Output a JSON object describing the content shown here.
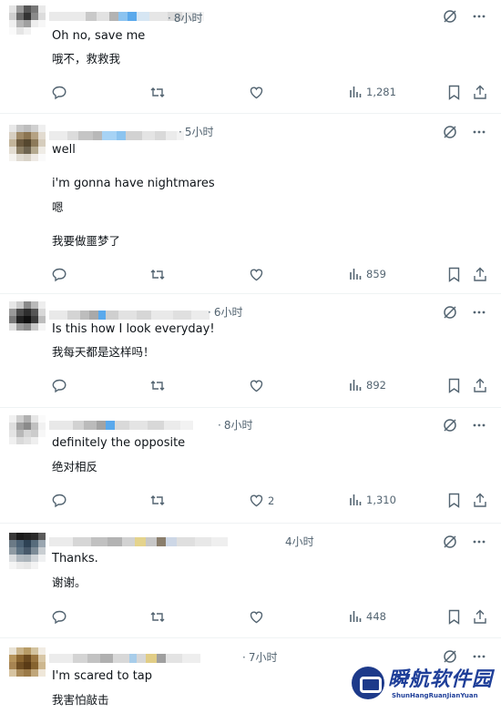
{
  "replies": [
    {
      "time": "8小时",
      "lines": [
        "Oh no, save me",
        "哦不，救救我"
      ],
      "reply_count": "",
      "like_count": "",
      "views": "1,281"
    },
    {
      "time": "5小时",
      "lines": [
        "well",
        "i'm gonna have nightmares",
        "嗯",
        "我要做噩梦了"
      ],
      "reply_count": "",
      "like_count": "",
      "views": "859"
    },
    {
      "time": "6小时",
      "lines": [
        "Is this how I look everyday!",
        "我每天都是这样吗！"
      ],
      "reply_count": "",
      "like_count": "",
      "views": "892"
    },
    {
      "time": "8小时",
      "lines": [
        "definitely the opposite",
        "绝对相反"
      ],
      "reply_count": "",
      "like_count": "2",
      "views": "1,310"
    },
    {
      "time": "4小时",
      "lines": [
        "Thanks.",
        "谢谢。"
      ],
      "reply_count": "",
      "like_count": "",
      "views": "448"
    },
    {
      "time": "7小时",
      "lines": [
        "I'm scared to tap",
        "我害怕敲击"
      ],
      "reply_count": "",
      "like_count": "",
      "views": ""
    }
  ],
  "watermark": {
    "title": "瞬航软件园",
    "subtitle": "ShunHangRuanJianYuan"
  },
  "icons": {
    "reply": "reply-icon",
    "repost": "repost-icon",
    "like": "like-icon",
    "views": "views-icon",
    "bookmark": "bookmark-icon",
    "share": "share-icon",
    "grok": "grok-icon",
    "more": "more-icon"
  },
  "colors": {
    "text": "#0f1419",
    "secondary": "#536471",
    "divider": "#eff3f4",
    "watermark": "#1f3f99"
  }
}
